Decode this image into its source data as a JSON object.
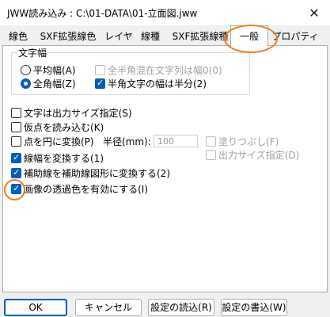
{
  "window": {
    "title": "JWW読み込み : C:\\01-DATA\\01-立面図.jww",
    "close_glyph": "✕"
  },
  "tabs": [
    {
      "label": "線色"
    },
    {
      "label": "SXF拡張線色"
    },
    {
      "label": "レイヤ"
    },
    {
      "label": "線種"
    },
    {
      "label": "SXF拡張線種"
    },
    {
      "label": "一般"
    },
    {
      "label": "プロパティ"
    }
  ],
  "font_width_group": {
    "label": "文字幅",
    "radio_average": "平均幅(A)",
    "radio_full": "全角幅(Z)",
    "selected": "全角幅(Z)",
    "check_mixed": "全半角混在文字列は幅0(0)",
    "check_mixed_value": false,
    "check_half": "半角文字の幅は半分(2)",
    "check_half_value": true
  },
  "options": {
    "text_output_size": "文字は出力サイズ指定(S)",
    "text_output_size_value": false,
    "read_temp_points": "仮点を読み込む(K)",
    "read_temp_points_value": false,
    "point_to_circle": "点を円に変換(P)",
    "point_to_circle_value": false,
    "radius_label": "半径(mm):",
    "radius_value": "100",
    "fill_label": "塗りつぶし(F)",
    "fill_value": false,
    "output_size_label": "出力サイズ指定(D)",
    "output_size_value": false,
    "convert_line_width": "線幅を変換する(1)",
    "convert_line_width_value": true,
    "convert_aux_lines": "補助線を補助線図形に変換する(2)",
    "convert_aux_lines_value": true,
    "image_transparency": "画像の透過色を有効にする(I)",
    "image_transparency_value": true
  },
  "buttons": {
    "ok": "OK",
    "cancel": "キャンセル",
    "load_settings": "設定の読込(R)",
    "save_settings": "設定の書込(W)"
  },
  "colors": {
    "accent": "#005fb8",
    "highlight": "#f07d1a"
  }
}
